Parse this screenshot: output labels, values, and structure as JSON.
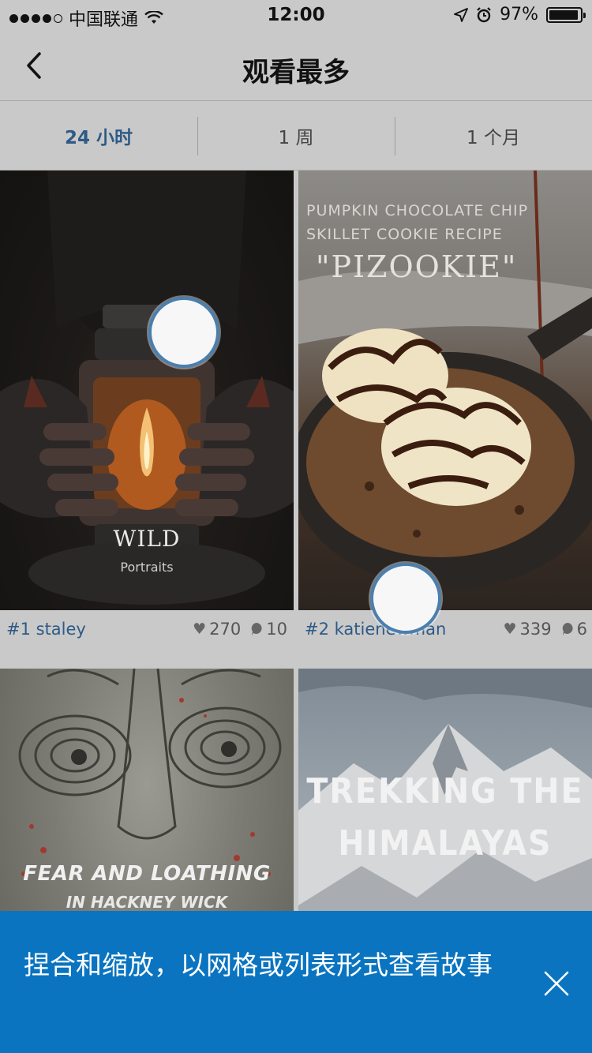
{
  "status_bar": {
    "carrier": "中国联通",
    "time": "12:00",
    "battery": "97%"
  },
  "nav": {
    "title": "观看最多",
    "back_icon": "chevron-left-icon"
  },
  "tabs": [
    {
      "label": "24 小时",
      "active": true
    },
    {
      "label": "1 周",
      "active": false
    },
    {
      "label": "1 个月",
      "active": false
    }
  ],
  "stories": [
    {
      "rank_user": "#1 staley",
      "likes": "270",
      "comments": "10",
      "cover_title": "WILD",
      "cover_subtitle": "Portraits"
    },
    {
      "rank_user": "#2 katienewman",
      "likes": "339",
      "comments": "6",
      "cover_line1": "PUMPKIN CHOCOLATE CHIP",
      "cover_line2": "SKILLET COOKIE RECIPE",
      "cover_title": "\"PIZOOKIE\""
    },
    {
      "cover_title": "FEAR AND LOATHING",
      "cover_subtitle": "IN HACKNEY WICK"
    },
    {
      "cover_line1": "TREKKING THE",
      "cover_line2": "HIMALAYAS"
    }
  ],
  "tip": {
    "text": "捏合和缩放，以网格或列表形式查看故事",
    "close_icon": "close-icon"
  },
  "colors": {
    "accent": "#2e5a86",
    "banner": "#0a74c0",
    "marker_ring": "#4a7fae"
  }
}
